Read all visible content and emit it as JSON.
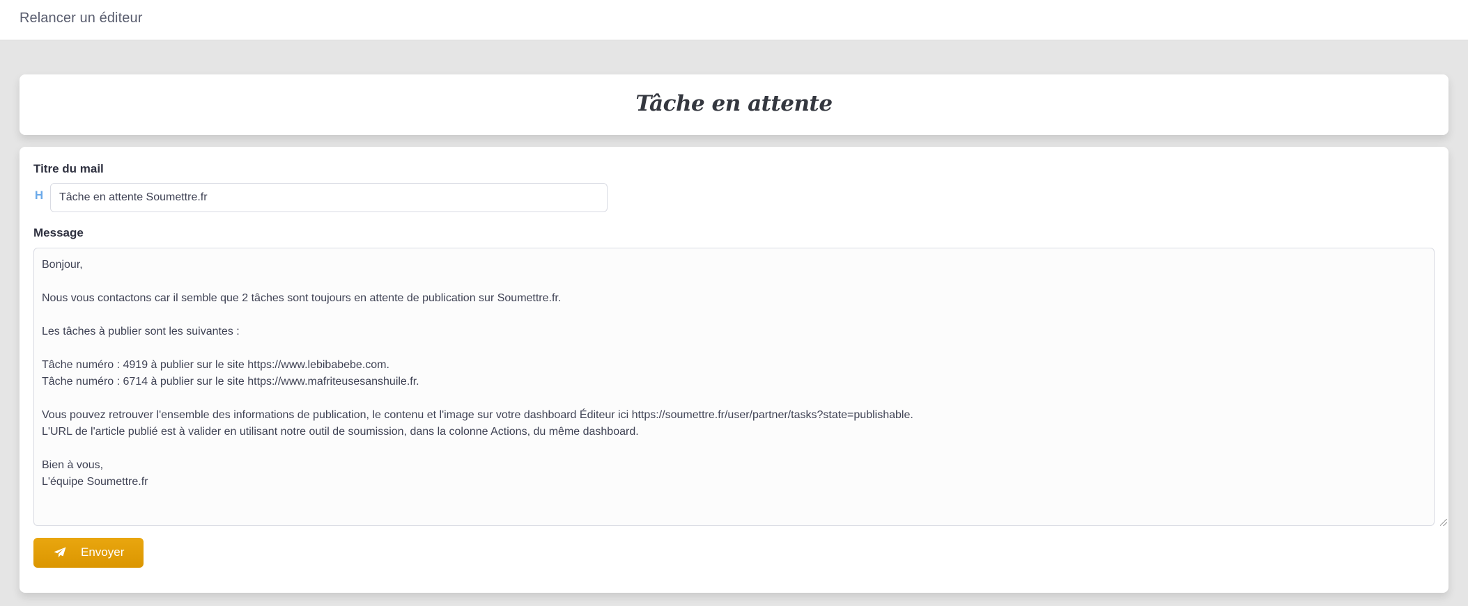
{
  "header": {
    "title": "Relancer un éditeur"
  },
  "card": {
    "title": "Tâche en attente"
  },
  "form": {
    "title_label": "Titre du mail",
    "title_icon": "H",
    "title_value": "Tâche en attente Soumettre.fr",
    "message_label": "Message",
    "message_value": "Bonjour,\n\nNous vous contactons car il semble que 2 tâches sont toujours en attente de publication sur Soumettre.fr.\n\nLes tâches à publier sont les suivantes :\n\nTâche numéro : 4919 à publier sur le site https://www.lebibabebe.com.\nTâche numéro : 6714 à publier sur le site https://www.mafriteusesanshuile.fr.\n\nVous pouvez retrouver l'ensemble des informations de publication, le contenu et l'image sur votre dashboard Éditeur ici https://soumettre.fr/user/partner/tasks?state=publishable.\nL'URL de l'article publié est à valider en utilisant notre outil de soumission, dans la colonne Actions, du même dashboard.\n\nBien à vous,\nL'équipe Soumettre.fr",
    "send_label": "Envoyer",
    "send_icon": "paper-plane-icon"
  },
  "colors": {
    "page_background": "#e5e5e5",
    "card_background": "#ffffff",
    "button_accent": "#e19f07",
    "icon_accent": "#6aa9e9"
  }
}
